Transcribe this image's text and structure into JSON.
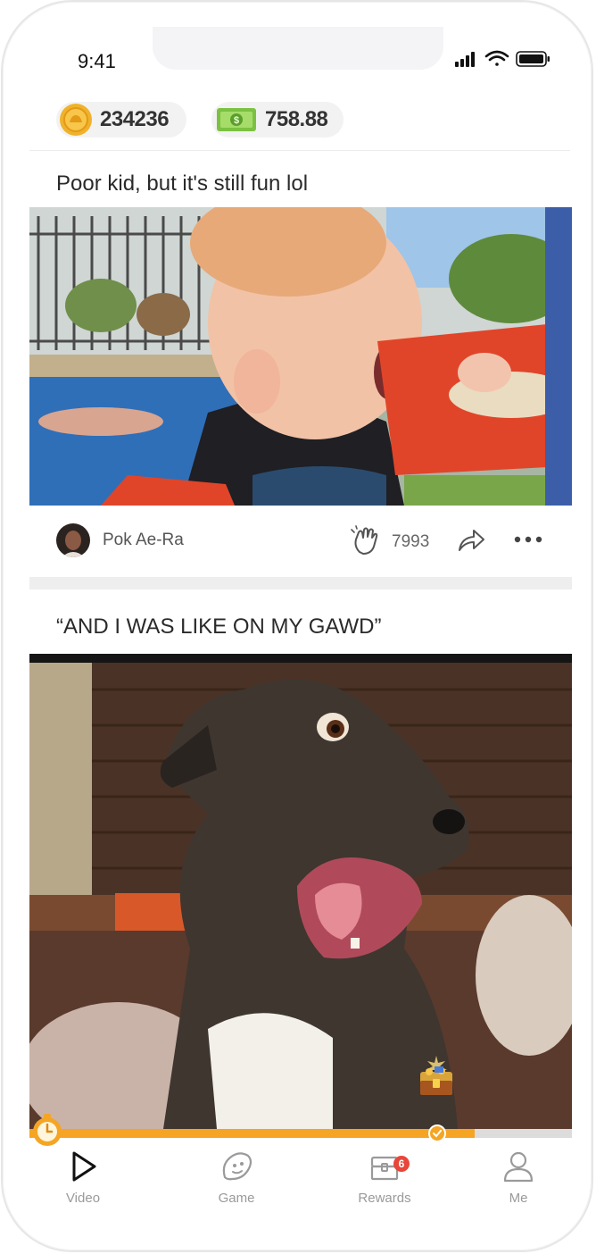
{
  "status_bar": {
    "time": "9:41"
  },
  "balances": {
    "coins": "234236",
    "cash": "758.88"
  },
  "posts": [
    {
      "title": "Poor kid, but it's still fun lol",
      "author": "Pok Ae-Ra",
      "claps": "7993"
    },
    {
      "title": "“AND I WAS LIKE ON MY GAWD”"
    }
  ],
  "video_progress": 0.82,
  "tabs": [
    {
      "label": "Video",
      "icon": "play-icon",
      "active": true
    },
    {
      "label": "Game",
      "icon": "game-icon"
    },
    {
      "label": "Rewards",
      "icon": "rewards-icon",
      "badge": "6"
    },
    {
      "label": "Me",
      "icon": "user-icon"
    }
  ],
  "colors": {
    "accent": "#f5a523",
    "badge": "#e8463a",
    "cash": "#7cc142"
  }
}
